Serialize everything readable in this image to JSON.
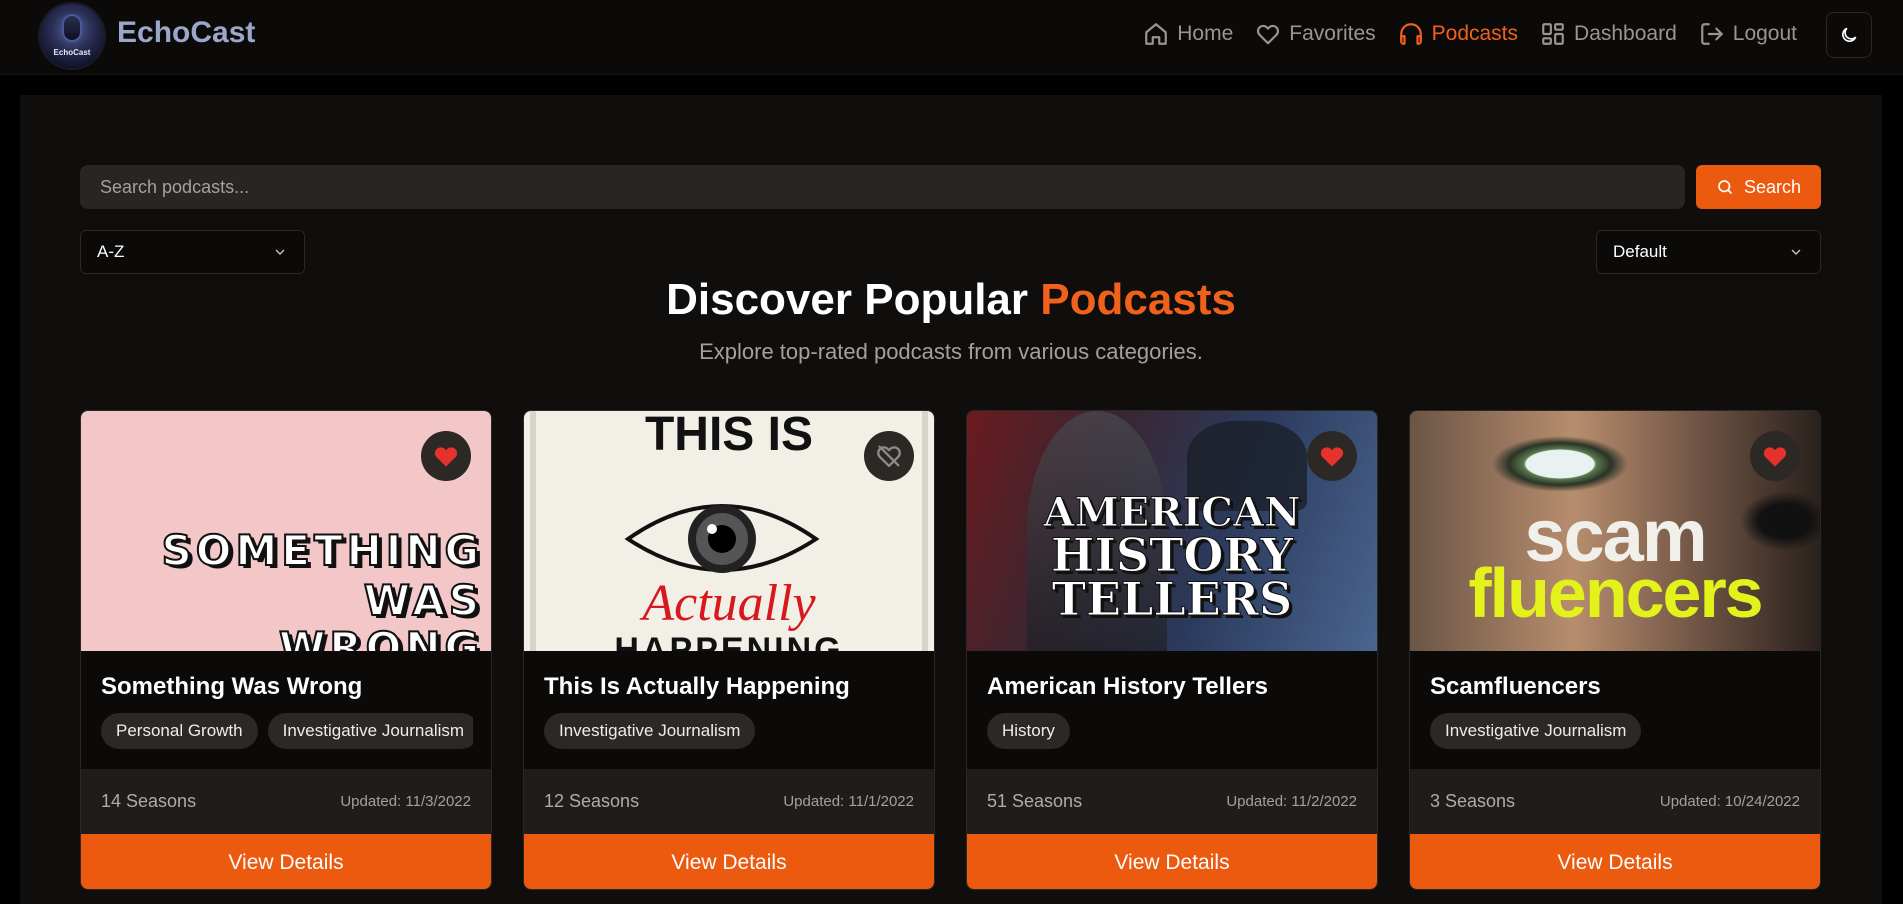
{
  "brand": {
    "logo_text": "EchoCast",
    "name": "EchoCast"
  },
  "nav": {
    "items": [
      {
        "label": "Home",
        "icon": "home-icon"
      },
      {
        "label": "Favorites",
        "icon": "heart-icon"
      },
      {
        "label": "Podcasts",
        "icon": "headphones-icon",
        "active": true
      },
      {
        "label": "Dashboard",
        "icon": "dashboard-icon"
      },
      {
        "label": "Logout",
        "icon": "logout-icon"
      }
    ],
    "theme_toggle_icon": "moon-icon"
  },
  "search": {
    "placeholder": "Search podcasts...",
    "value": "",
    "button_label": "Search"
  },
  "sort_select": {
    "value": "A-Z"
  },
  "filter_select": {
    "value": "Default"
  },
  "hero": {
    "title_prefix": "Discover Popular ",
    "title_accent": "Podcasts",
    "subtitle": "Explore top-rated podcasts from various categories."
  },
  "colors": {
    "accent": "#eb5a0e",
    "background": "#000000",
    "card": "#0b0a09",
    "favorite": "#e5322d"
  },
  "podcasts": [
    {
      "title": "Something Was Wrong",
      "cover_text": [
        "SOMETHING",
        "WAS",
        "WRONG"
      ],
      "favorited": true,
      "tags": [
        "Personal Growth",
        "Investigative Journalism"
      ],
      "seasons": "14 Seasons",
      "updated": "Updated: 11/3/2022",
      "button_label": "View Details"
    },
    {
      "title": "This Is Actually Happening",
      "cover_text": [
        "THIS IS",
        "Actually",
        "HAPPENING"
      ],
      "favorited": false,
      "tags": [
        "Investigative Journalism"
      ],
      "seasons": "12 Seasons",
      "updated": "Updated: 11/1/2022",
      "button_label": "View Details"
    },
    {
      "title": "American History Tellers",
      "cover_text": [
        "AMERICAN",
        "HISTORY",
        "TELLERS"
      ],
      "favorited": true,
      "tags": [
        "History"
      ],
      "seasons": "51 Seasons",
      "updated": "Updated: 11/2/2022",
      "button_label": "View Details"
    },
    {
      "title": "Scamfluencers",
      "cover_text": [
        "scam",
        "fluencers"
      ],
      "favorited": true,
      "tags": [
        "Investigative Journalism"
      ],
      "seasons": "3 Seasons",
      "updated": "Updated: 10/24/2022",
      "button_label": "View Details"
    }
  ]
}
